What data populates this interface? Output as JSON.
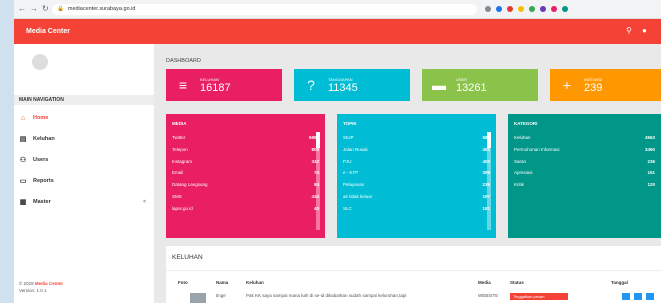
{
  "browser": {
    "url": "mediacenter.surabaya.go.id"
  },
  "app": {
    "title": "Media Center",
    "search_icon": "search-icon",
    "bell_icon": "bell-icon"
  },
  "sidebar": {
    "nav_header": "MAIN NAVIGATION",
    "items": [
      {
        "label": "Home",
        "icon": "home-icon",
        "active": true
      },
      {
        "label": "Keluhan",
        "icon": "inbox-icon"
      },
      {
        "label": "Users",
        "icon": "users-icon"
      },
      {
        "label": "Reports",
        "icon": "card-icon"
      },
      {
        "label": "Master",
        "icon": "grid-icon",
        "chevron": "<"
      }
    ],
    "footer_year": "© 2018 ",
    "footer_brand": "Media Center",
    "version": "Version: 1.0.1"
  },
  "dashboard": {
    "label": "DASHBOARD"
  },
  "cards": [
    {
      "label": "KELUHAN",
      "value": "16187",
      "color": "#e91e63",
      "icon": "list-icon"
    },
    {
      "label": "TANGGAPAN",
      "value": "11345",
      "color": "#00bcd4",
      "icon": "question-icon"
    },
    {
      "label": "USER",
      "value": "13261",
      "color": "#8bc34a",
      "icon": "chat-icon"
    },
    {
      "label": "INSTANSI",
      "value": "239",
      "color": "#ff9800",
      "icon": "person-add-icon"
    }
  ],
  "panels": [
    {
      "title": "MEDIA",
      "color": "#e91e63",
      "rows": [
        {
          "name": "Twitter",
          "value": "5862"
        },
        {
          "name": "Telepon",
          "value": "809"
        },
        {
          "name": "Instagram",
          "value": "342"
        },
        {
          "name": "Email",
          "value": "74"
        },
        {
          "name": "Datang Langsung",
          "value": "84"
        },
        {
          "name": "SMS",
          "value": "434"
        },
        {
          "name": "lapor.go.id",
          "value": "40"
        }
      ]
    },
    {
      "title": "TOPIK",
      "color": "#00bcd4",
      "rows": [
        {
          "name": "SIUP",
          "value": "587"
        },
        {
          "name": "Jalan Rusak",
          "value": "481"
        },
        {
          "name": "PJU",
          "value": "400"
        },
        {
          "name": "e - KTP",
          "value": "399"
        },
        {
          "name": "Pelayanan",
          "value": "235"
        },
        {
          "name": "air tidak keluar",
          "value": "197"
        },
        {
          "name": "SLC",
          "value": "181"
        }
      ]
    },
    {
      "title": "KATEGORI",
      "color": "#009688",
      "rows": [
        {
          "name": "Keluhan",
          "value": "4563"
        },
        {
          "name": "Permohonan Informasi",
          "value": "3490"
        },
        {
          "name": "Saran",
          "value": "236"
        },
        {
          "name": "Apresiasi",
          "value": "151"
        },
        {
          "name": "Kritik",
          "value": "120"
        }
      ]
    }
  ],
  "keluhan_table": {
    "title": "KELUHAN",
    "columns": [
      "Foto",
      "Nama",
      "Keluhan",
      "Media",
      "Status",
      "Tanggal"
    ],
    "row": {
      "nama": "tinge",
      "keluhan": "Pak KK saya sampai mana kah di se-id dikabarkan sudah sampai keluruhan,tapi",
      "media": "WEBSITE",
      "status": "Tinggalkan pesan"
    }
  }
}
